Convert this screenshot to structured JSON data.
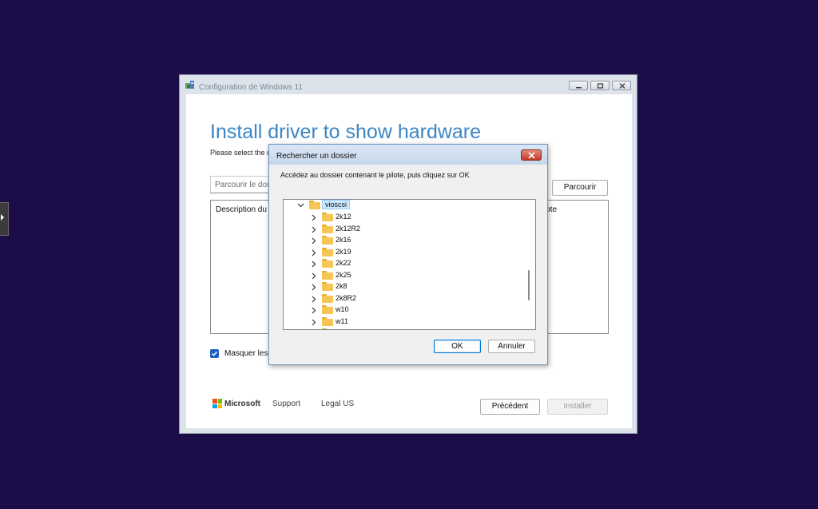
{
  "window": {
    "title": "Configuration de Windows 11"
  },
  "page": {
    "title": "Install driver to show hardware",
    "subtitle": "Please select the d",
    "path_placeholder": "Parcourir le doss",
    "browse_label": "Parcourir",
    "description_header": "Description du p",
    "column_header": "lote",
    "hide_checkbox_label": "Masquer les p",
    "hide_checkbox_checked": true
  },
  "footer": {
    "brand": "Microsoft",
    "support_link": "Support",
    "legal_link": "Legal US",
    "back_label": "Précédent",
    "install_label": "Installer"
  },
  "dialog": {
    "title": "Rechercher un dossier",
    "instruction": "Accédez au dossier contenant le pilote, puis cliquez sur OK",
    "selected_folder": "vioscsi",
    "folders": [
      "2k12",
      "2k12R2",
      "2k16",
      "2k19",
      "2k22",
      "2k25",
      "2k8",
      "2k8R2",
      "w10",
      "w11"
    ],
    "ok_label": "OK",
    "cancel_label": "Annuler"
  },
  "colors": {
    "desktop": "#1c0c48",
    "title_blue": "#3b86c5",
    "folder_yellow": "#f6c654",
    "selection": "#cce8ff",
    "checkbox": "#1f5fbf"
  },
  "icons": {
    "app": "setup-icon",
    "folder": "folder-icon",
    "expand": "chevron-right-icon",
    "collapse": "chevron-down-icon",
    "close": "close-icon",
    "cursor": "mouse-pointer-icon"
  }
}
